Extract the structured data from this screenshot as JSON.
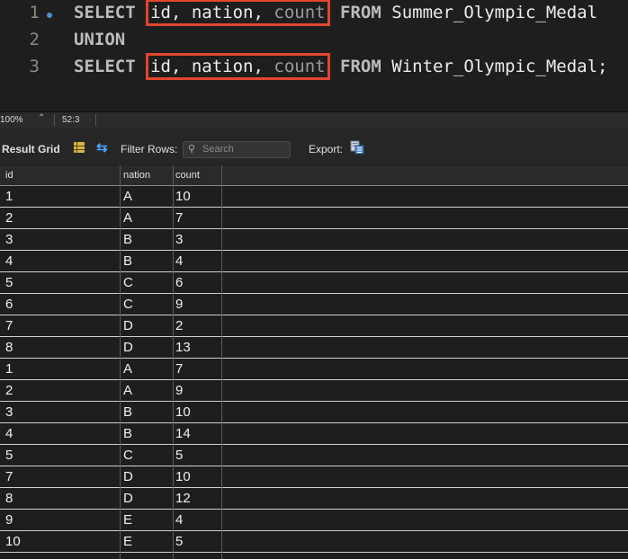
{
  "editor": {
    "lines": [
      {
        "num": "1",
        "kw1": "SELECT",
        "cols_a": "id, nation, ",
        "cols_b": "count",
        "kw2": "FROM",
        "table": "Summer_Olympic_Medal"
      },
      {
        "num": "2",
        "kw1": "UNION"
      },
      {
        "num": "3",
        "kw1": "SELECT",
        "cols_a": "id, nation, ",
        "cols_b": "count",
        "kw2": "FROM",
        "table": "Winter_Olympic_Medal;"
      }
    ]
  },
  "statusbar": {
    "zoom": "100%",
    "cursor": "52:3"
  },
  "toolbar": {
    "result_grid_label": "Result Grid",
    "filter_label": "Filter Rows:",
    "search_placeholder": "Search",
    "export_label": "Export:"
  },
  "colors": {
    "highlight_box": "#e2452f",
    "accent": "#4aa3ff",
    "background": "#1e1e1e"
  },
  "grid": {
    "columns": [
      "id",
      "nation",
      "count"
    ],
    "rows": [
      [
        "1",
        "A",
        "10"
      ],
      [
        "2",
        "A",
        "7"
      ],
      [
        "3",
        "B",
        "3"
      ],
      [
        "4",
        "B",
        "4"
      ],
      [
        "5",
        "C",
        "6"
      ],
      [
        "6",
        "C",
        "9"
      ],
      [
        "7",
        "D",
        "2"
      ],
      [
        "8",
        "D",
        "13"
      ],
      [
        "1",
        "A",
        "7"
      ],
      [
        "2",
        "A",
        "9"
      ],
      [
        "3",
        "B",
        "10"
      ],
      [
        "4",
        "B",
        "14"
      ],
      [
        "5",
        "C",
        "5"
      ],
      [
        "7",
        "D",
        "10"
      ],
      [
        "8",
        "D",
        "12"
      ],
      [
        "9",
        "E",
        "4"
      ],
      [
        "10",
        "E",
        "5"
      ]
    ]
  }
}
